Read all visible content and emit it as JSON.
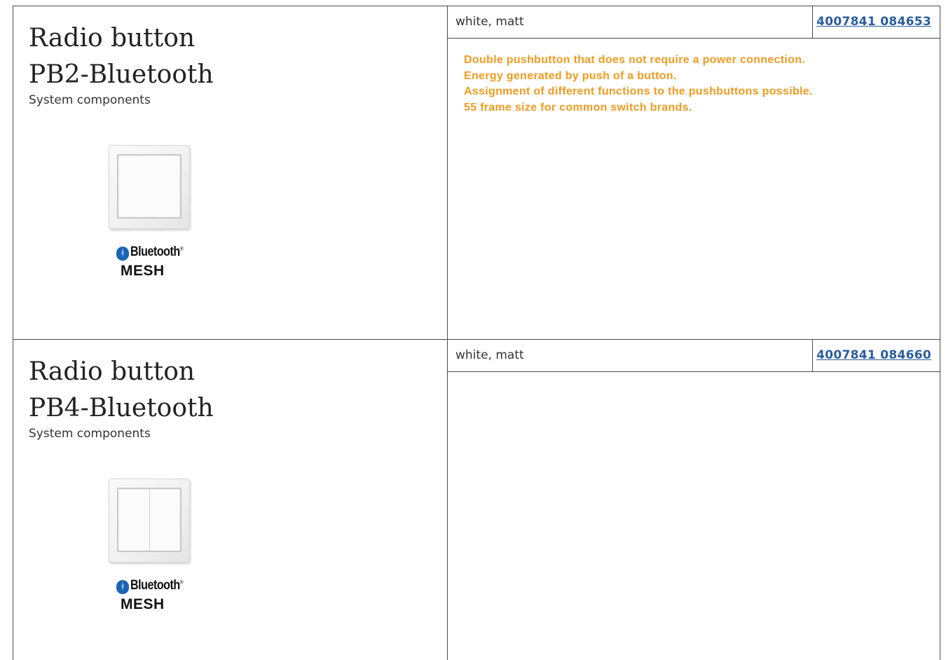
{
  "products": [
    {
      "title_line1": "Radio button",
      "title_line2": "PB2-Bluetooth",
      "category": "System components",
      "finish": "white, matt",
      "ean": "4007841 084653",
      "logo": {
        "word": "Bluetooth",
        "mesh": "MESH",
        "badge_symbol": "ᚼ",
        "trademark": "®"
      },
      "description": [
        "Double pushbutton that does not require a power connection.",
        "Energy generated by push of a button.",
        "Assignment of different functions to the pushbuttons possible.",
        "55 frame size for common switch brands."
      ]
    },
    {
      "title_line1": "Radio button",
      "title_line2": "PB4-Bluetooth",
      "category": "System components",
      "finish": "white, matt",
      "ean": "4007841 084660",
      "logo": {
        "word": "Bluetooth",
        "mesh": "MESH",
        "badge_symbol": "ᚼ",
        "trademark": "®"
      },
      "description": []
    }
  ],
  "colors": {
    "border": "#4a4a4a",
    "description_text": "#f29a1f",
    "link": "#2b5d9e",
    "bluetooth_badge": "#1a63b5"
  },
  "icons": [
    "bluetooth-icon"
  ]
}
